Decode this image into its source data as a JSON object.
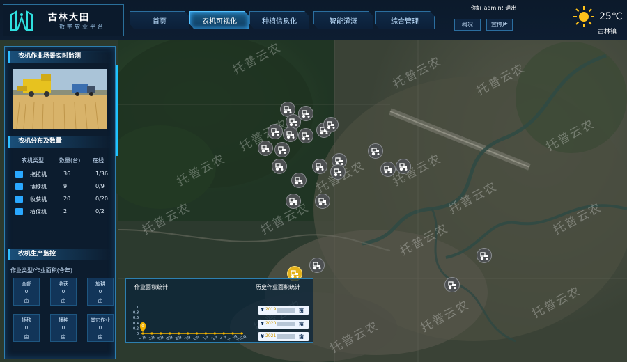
{
  "header": {
    "brand_name": "古林大田",
    "brand_sub": "数字农业平台",
    "tabs": [
      {
        "label": "首页"
      },
      {
        "label": "农机可视化"
      },
      {
        "label": "种植信息化"
      },
      {
        "label": "智能灌溉"
      },
      {
        "label": "综合管理"
      }
    ],
    "active_tab": "农机可视化",
    "welcome": "你好,admin! 退出",
    "sub_buttons": [
      {
        "label": "概况"
      },
      {
        "label": "宣传片"
      }
    ],
    "weather": {
      "temp": "25℃",
      "location": "古林镇",
      "icon": "sun-icon"
    }
  },
  "watermark": "托普云农",
  "left_panel": {
    "live_title": "农机作业场景实时监测",
    "dist_title": "农机分布及数量",
    "table_headers": [
      "农机类型",
      "数量(台)",
      "在线"
    ],
    "table_rows": [
      {
        "type": "拖拉机",
        "count": "36",
        "online": "1/36"
      },
      {
        "type": "插秧机",
        "count": "9",
        "online": "0/9"
      },
      {
        "type": "收获机",
        "count": "20",
        "online": "0/20"
      },
      {
        "type": "植保机",
        "count": "2",
        "online": "0/2"
      }
    ],
    "monitor_title": "农机生产监控",
    "monitor_caption": "作业类型/作业面积(今年)",
    "stats": [
      {
        "label": "全部",
        "value": "0",
        "unit": "亩"
      },
      {
        "label": "收获",
        "value": "0",
        "unit": "亩"
      },
      {
        "label": "旋耕",
        "value": "0",
        "unit": "亩"
      },
      {
        "label": "插秧",
        "value": "0",
        "unit": "亩"
      },
      {
        "label": "播种",
        "value": "0",
        "unit": "亩"
      },
      {
        "label": "其它作业",
        "value": "0",
        "unit": "亩"
      }
    ]
  },
  "bottom_panel": {
    "left_title": "作业面积统计",
    "right_title": "历史作业面积统计",
    "history": [
      {
        "symbol": "¥",
        "year": "2019",
        "unit": "亩"
      },
      {
        "symbol": "¥",
        "year": "2020",
        "unit": "亩"
      },
      {
        "symbol": "¥",
        "year": "2021",
        "unit": "亩"
      }
    ]
  },
  "chart_data": {
    "type": "line",
    "categories": [
      "一月",
      "二月",
      "三月",
      "四月",
      "五月",
      "六月",
      "七月",
      "八月",
      "九月",
      "十月",
      "十一月",
      "十二月"
    ],
    "series": [
      {
        "values": [
          0,
          0,
          0,
          0,
          0,
          0,
          0,
          0,
          0,
          0,
          0,
          0
        ]
      }
    ],
    "ylim": [
      0,
      1
    ],
    "yticks": [
      "1",
      "0.8",
      "0.6",
      "0.4",
      "0.2",
      "0"
    ],
    "point_label": "0",
    "colors": {
      "line": "#f4b400"
    }
  },
  "brand_colors": {
    "accent": "#2fc0ff",
    "panel": "#0a1a2e"
  }
}
